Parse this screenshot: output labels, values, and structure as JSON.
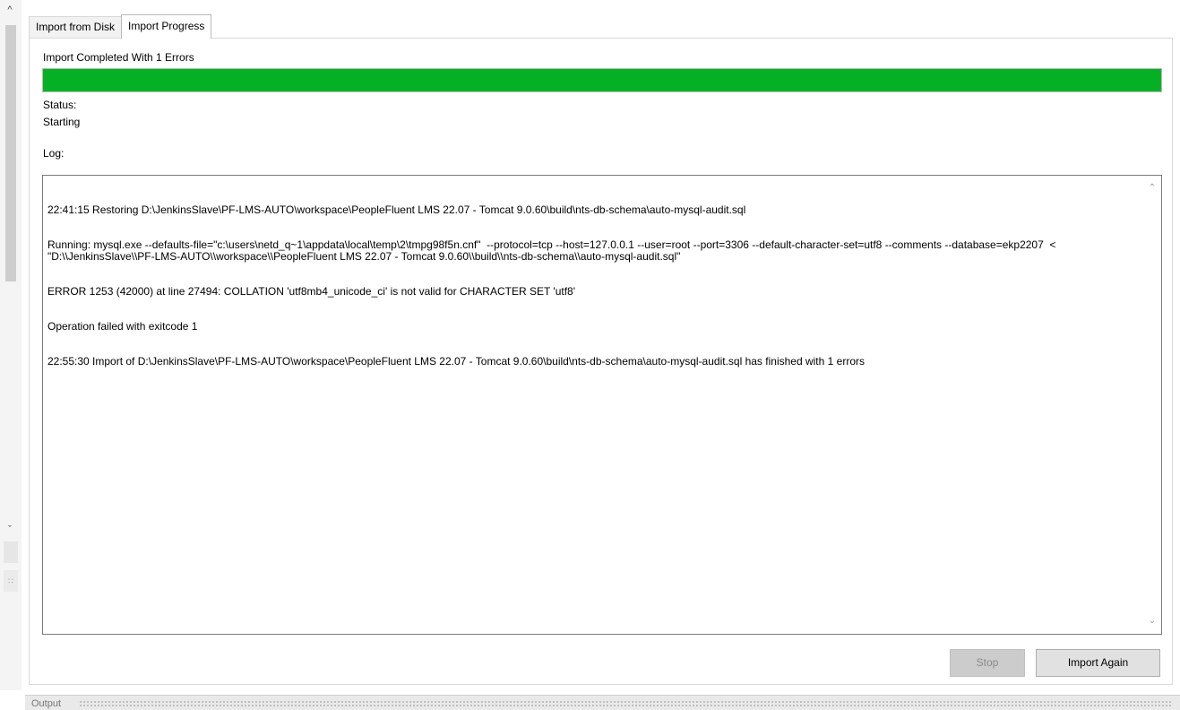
{
  "tabs": [
    {
      "label": "Import from Disk",
      "active": false
    },
    {
      "label": "Import Progress",
      "active": true
    }
  ],
  "progress": {
    "heading": "Import Completed With 1 Errors",
    "fraction": 1.0,
    "bar_color": "#06b025"
  },
  "status": {
    "label": "Status:",
    "value": "Starting"
  },
  "log": {
    "label": "Log:",
    "lines": [
      "22:41:15 Restoring D:\\JenkinsSlave\\PF-LMS-AUTO\\workspace\\PeopleFluent LMS 22.07 - Tomcat 9.0.60\\build\\nts-db-schema\\auto-mysql-audit.sql",
      "Running: mysql.exe --defaults-file=\"c:\\users\\netd_q~1\\appdata\\local\\temp\\2\\tmpg98f5n.cnf\"  --protocol=tcp --host=127.0.0.1 --user=root --port=3306 --default-character-set=utf8 --comments --database=ekp2207  < \"D:\\\\JenkinsSlave\\\\PF-LMS-AUTO\\\\workspace\\\\PeopleFluent LMS 22.07 - Tomcat 9.0.60\\\\build\\\\nts-db-schema\\\\auto-mysql-audit.sql\"",
      "ERROR 1253 (42000) at line 27494: COLLATION 'utf8mb4_unicode_ci' is not valid for CHARACTER SET 'utf8'",
      "Operation failed with exitcode 1",
      "22:55:30 Import of D:\\JenkinsSlave\\PF-LMS-AUTO\\workspace\\PeopleFluent LMS 22.07 - Tomcat 9.0.60\\build\\nts-db-schema\\auto-mysql-audit.sql has finished with 1 errors"
    ]
  },
  "buttons": {
    "stop": "Stop",
    "import_again": "Import Again"
  },
  "output_bar": {
    "label": "Output"
  }
}
